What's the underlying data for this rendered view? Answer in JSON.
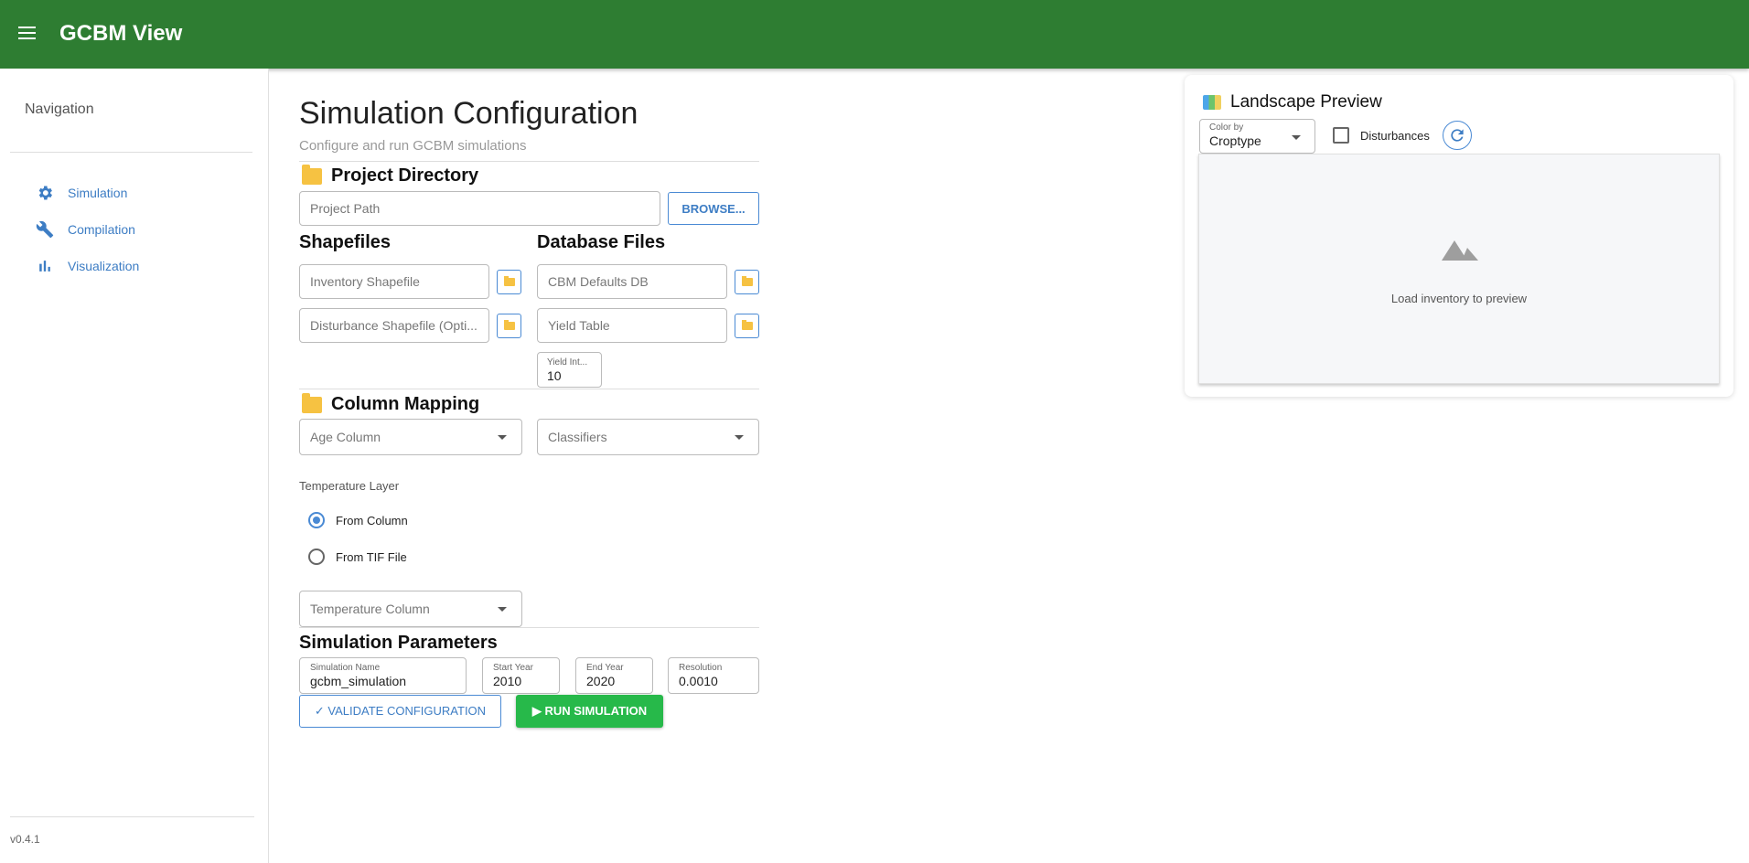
{
  "app": {
    "title": "GCBM View"
  },
  "sidebar": {
    "heading": "Navigation",
    "items": [
      {
        "label": "Simulation",
        "icon": "gear-icon"
      },
      {
        "label": "Compilation",
        "icon": "wrench-icon"
      },
      {
        "label": "Visualization",
        "icon": "bar-chart-icon"
      }
    ],
    "version": "v0.4.1"
  },
  "page": {
    "title": "Simulation Configuration",
    "subtitle": "Configure and run GCBM simulations"
  },
  "project_directory": {
    "title": "Project Directory",
    "path_placeholder": "Project Path",
    "browse_label": "BROWSE..."
  },
  "shapefiles": {
    "title": "Shapefiles",
    "inventory_placeholder": "Inventory Shapefile",
    "disturbance_placeholder": "Disturbance Shapefile (Opti..."
  },
  "database_files": {
    "title": "Database Files",
    "cbm_placeholder": "CBM Defaults DB",
    "yield_placeholder": "Yield Table",
    "yield_interval_label": "Yield Int...",
    "yield_interval_value": "10"
  },
  "column_mapping": {
    "title": "Column Mapping",
    "age_placeholder": "Age Column",
    "classifiers_placeholder": "Classifiers",
    "temperature_label": "Temperature Layer",
    "radio_from_column": "From Column",
    "radio_from_tif": "From TIF File",
    "selected_radio": "From Column",
    "temperature_placeholder": "Temperature Column"
  },
  "simulation_parameters": {
    "title": "Simulation Parameters",
    "name_label": "Simulation Name",
    "name_value": "gcbm_simulation",
    "start_label": "Start Year",
    "start_value": "2010",
    "end_label": "End Year",
    "end_value": "2020",
    "resolution_label": "Resolution",
    "resolution_value": "0.0010",
    "validate_label": "✓ VALIDATE CONFIGURATION",
    "run_label": "▶ RUN SIMULATION"
  },
  "preview": {
    "title": "Landscape Preview",
    "color_by_label": "Color by",
    "color_by_value": "Croptype",
    "disturbances_label": "Disturbances",
    "disturbances_checked": false,
    "empty_message": "Load inventory to preview"
  },
  "colors": {
    "appbar": "#2e7d32",
    "accent": "#3d7dc4",
    "run_button": "#27b94a",
    "folder": "#f6c242"
  }
}
